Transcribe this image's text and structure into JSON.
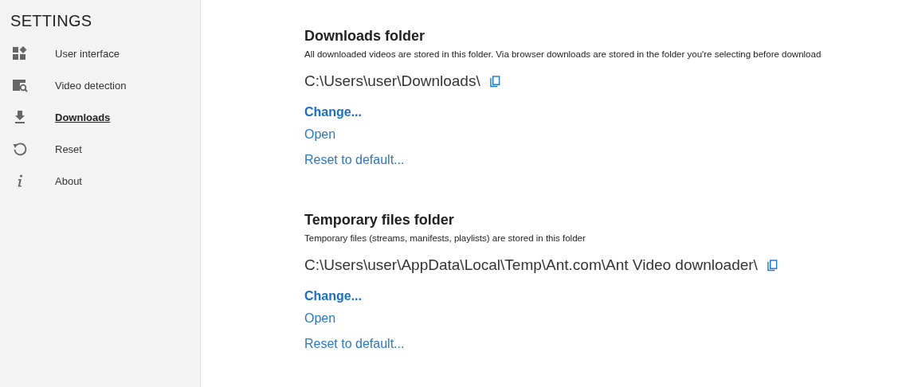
{
  "sidebar": {
    "title": "SETTINGS",
    "items": [
      {
        "kind": "widgets",
        "label": "User interface",
        "selected": false
      },
      {
        "kind": "video-search",
        "label": "Video detection",
        "selected": false
      },
      {
        "kind": "download",
        "label": "Downloads",
        "selected": true
      },
      {
        "kind": "reset",
        "label": "Reset",
        "selected": false
      },
      {
        "kind": "info",
        "label": "About",
        "selected": false
      }
    ]
  },
  "sections": [
    {
      "title": "Downloads folder",
      "description": "All downloaded videos are stored in this folder. Via browser downloads are stored in the folder you're selecting before download",
      "path": "C:\\Users\\user\\Downloads\\",
      "change": "Change...",
      "open": "Open",
      "reset": "Reset to default..."
    },
    {
      "title": "Temporary files folder",
      "description": "Temporary files (streams, manifests, playlists) are stored in this folder",
      "path": "C:\\Users\\user\\AppData\\Local\\Temp\\Ant.com\\Ant Video downloader\\",
      "change": "Change...",
      "open": "Open",
      "reset": "Reset to default..."
    }
  ]
}
